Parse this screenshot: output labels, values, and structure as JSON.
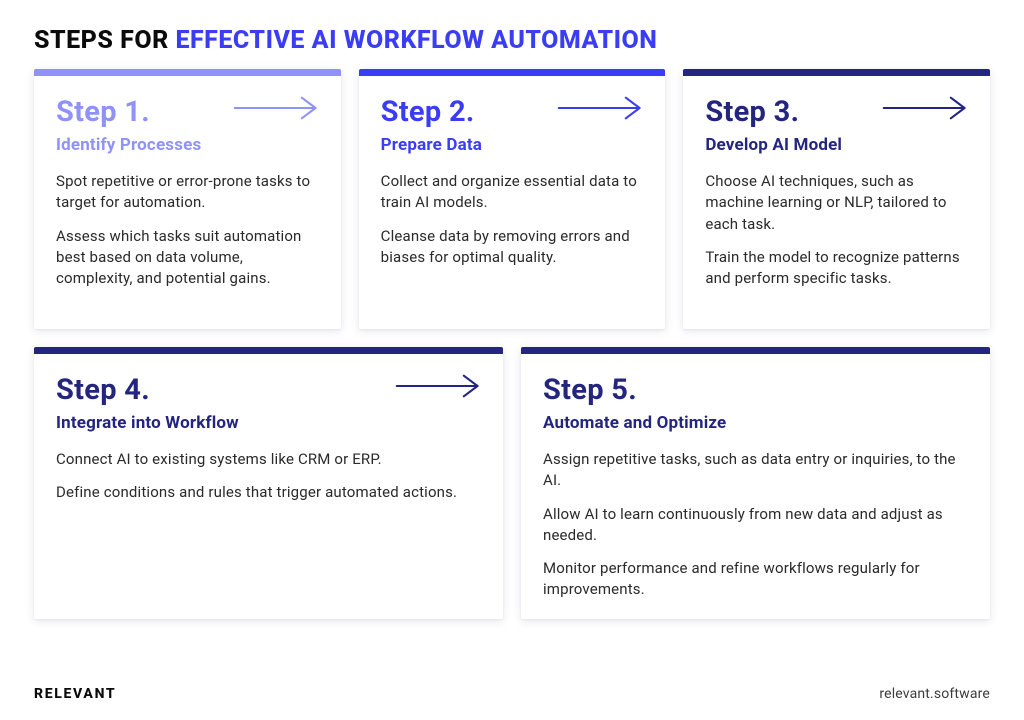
{
  "title": {
    "lead": "STEPS FOR ",
    "accent": "EFFECTIVE AI WORKFLOW AUTOMATION"
  },
  "steps": [
    {
      "label": "Step 1.",
      "subtitle": "Identify Processes",
      "shade": "light",
      "hasArrow": true,
      "paragraphs": [
        "Spot repetitive or error-prone tasks to target for automation.",
        "Assess which tasks suit automation best based on data volume, complexity, and potential gains."
      ]
    },
    {
      "label": "Step 2.",
      "subtitle": "Prepare Data",
      "shade": "mid",
      "hasArrow": true,
      "paragraphs": [
        "Collect and organize essential data to train AI models.",
        "Cleanse data by removing errors and biases for optimal quality."
      ]
    },
    {
      "label": "Step 3.",
      "subtitle": "Develop AI Model",
      "shade": "dark",
      "hasArrow": true,
      "paragraphs": [
        "Choose AI techniques, such as machine learning or NLP, tailored to each task.",
        "Train the model to recognize patterns and perform specific tasks."
      ]
    },
    {
      "label": "Step 4.",
      "subtitle": "Integrate into Workflow",
      "shade": "dark",
      "hasArrow": true,
      "paragraphs": [
        "Connect AI to existing systems like CRM or ERP.",
        "Define conditions and rules that trigger automated actions."
      ]
    },
    {
      "label": "Step 5.",
      "subtitle": "Automate and Optimize",
      "shade": "dark",
      "hasArrow": false,
      "paragraphs": [
        "Assign repetitive tasks, such as data entry or inquiries, to the AI.",
        "Allow AI to learn continuously from new data and adjust as needed.",
        "Monitor performance and refine workflows regularly for improvements."
      ]
    }
  ],
  "footer": {
    "brand": "RELEVANT",
    "site": "relevant.software"
  }
}
